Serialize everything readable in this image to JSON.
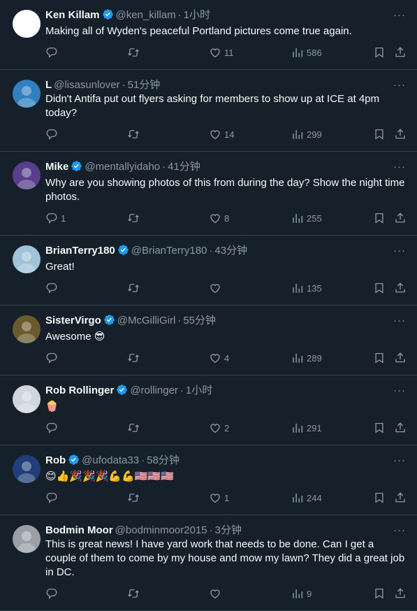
{
  "tweets": [
    {
      "name": "Ken Killam",
      "verified": true,
      "handle": "@ken_killam",
      "time": "1小时",
      "text": "Making all of Wyden's peaceful Portland pictures come true again.",
      "replies": "",
      "reposts": "",
      "likes": "11",
      "views": "586",
      "avatar_color": "#ffffff"
    },
    {
      "name": "L",
      "verified": false,
      "handle": "@lisasunlover",
      "time": "51分钟",
      "text": "Didn't Antifa put out flyers asking for members to show up at ICE at 4pm today?",
      "replies": "",
      "reposts": "",
      "likes": "14",
      "views": "299",
      "avatar_color": "#2f7fc1"
    },
    {
      "name": "Mike",
      "verified": true,
      "handle": "@mentallyidaho",
      "time": "41分钟",
      "text": "Why are you showing photos of this from during the day?  Show the night time photos.",
      "replies": "1",
      "reposts": "",
      "likes": "8",
      "views": "255",
      "avatar_color": "#5a3d8c"
    },
    {
      "name": "BrianTerry180",
      "verified": true,
      "handle": "@BrianTerry180",
      "time": "43分钟",
      "text": "Great!",
      "replies": "",
      "reposts": "",
      "likes": "",
      "views": "135",
      "avatar_color": "#9fc3d8"
    },
    {
      "name": "SisterVirgo",
      "verified": true,
      "handle": "@McGilliGirl",
      "time": "55分钟",
      "text": "Awesome 😎",
      "replies": "",
      "reposts": "",
      "likes": "4",
      "views": "289",
      "avatar_color": "#6b5a2e"
    },
    {
      "name": "Rob Rollinger",
      "verified": true,
      "handle": "@rollinger",
      "time": "1小时",
      "text": "🍿",
      "replies": "",
      "reposts": "",
      "likes": "2",
      "views": "291",
      "avatar_color": "#cfd6dc"
    },
    {
      "name": "Rob",
      "verified": true,
      "handle": "@ufodata33",
      "time": "58分钟",
      "text": "😊👍🎉🎉🎉💪💪🇺🇸🇺🇸🇺🇸",
      "replies": "",
      "reposts": "",
      "likes": "1",
      "views": "244",
      "avatar_color": "#1f3f7a"
    },
    {
      "name": "Bodmin Moor",
      "verified": false,
      "handle": "@bodminmoor2015",
      "time": "3分钟",
      "text": "This is great news!  I have yard work that needs to be done. Can I get a couple of them to come by my house and mow my lawn?  They did a great job in DC.",
      "replies": "",
      "reposts": "",
      "likes": "",
      "views": "9",
      "avatar_color": "#9aa0a4"
    }
  ],
  "separator": "·",
  "more_label": "···",
  "colors": {
    "background": "#15202b",
    "muted": "#8b98a5",
    "verified": "#1d9bf0",
    "divider": "#38444d"
  }
}
